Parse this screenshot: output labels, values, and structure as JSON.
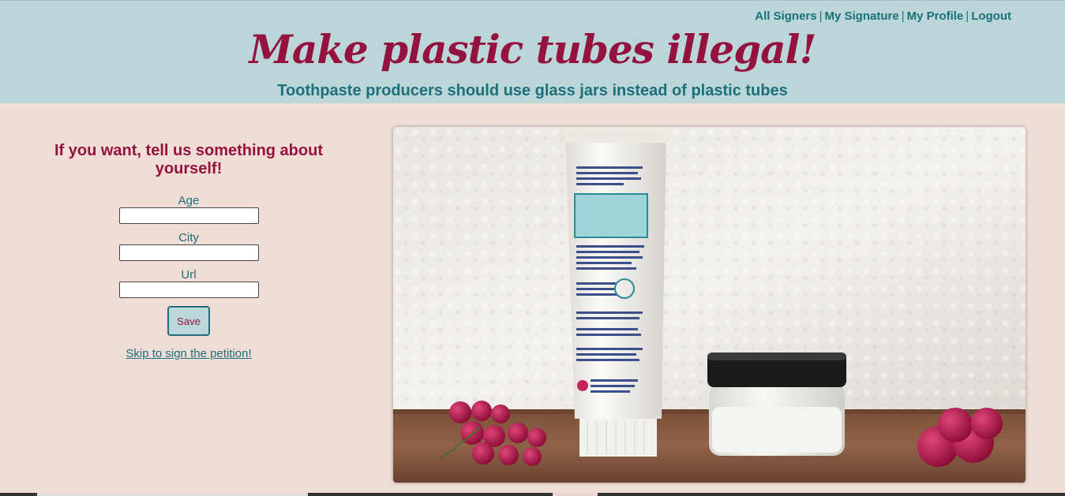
{
  "header": {
    "nav": [
      {
        "label": "All Signers"
      },
      {
        "label": "My Signature"
      },
      {
        "label": "My Profile"
      },
      {
        "label": "Logout"
      }
    ],
    "nav_separator": "|",
    "title": "Make plastic tubes illegal!",
    "subtitle": "Toothpaste producers should use glass jars instead of plastic tubes"
  },
  "form": {
    "heading": "If you want, tell us something about yourself!",
    "fields": [
      {
        "label": "Age",
        "value": ""
      },
      {
        "label": "City",
        "value": ""
      },
      {
        "label": "Url",
        "value": ""
      }
    ],
    "save_label": "Save",
    "skip_link": "Skip to sign the petition!"
  },
  "photo": {
    "subject": "toothpaste tube, glass jar and raspberries on a wooden table"
  },
  "colors": {
    "header_bg": "#bad6d8",
    "page_bg": "#efddd6",
    "accent_teal": "#1d6f79",
    "accent_crimson": "#95123f"
  }
}
